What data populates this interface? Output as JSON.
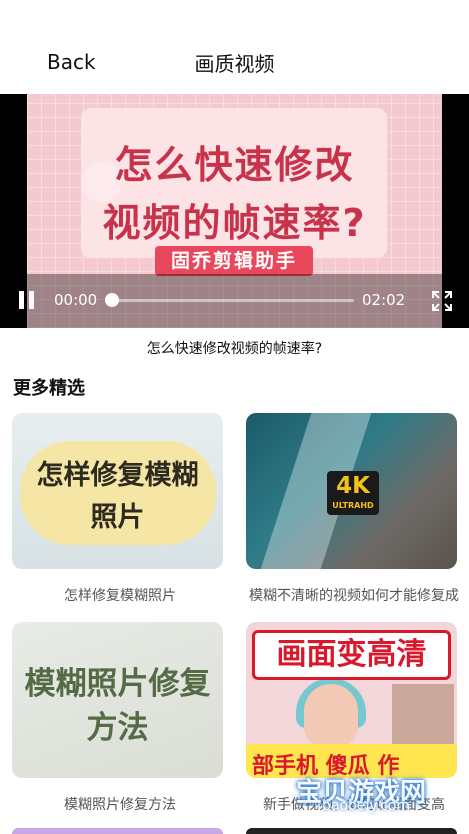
{
  "nav": {
    "back_label": "Back",
    "title": "画质视频"
  },
  "player": {
    "video_title_line1": "怎么快速修改",
    "video_title_line2": "视频的帧速率?",
    "video_brand": "固乔剪辑助手",
    "current_time": "00:00",
    "duration": "02:02",
    "progress_fraction": 0.0,
    "caption": "怎么快速修改视频的帧速率?"
  },
  "section_title": "更多精选",
  "items": [
    {
      "label": "怎样修复模糊照片",
      "thumb_text_1": "怎样修复模糊",
      "thumb_text_2": "照片"
    },
    {
      "label": "模糊不清晰的视频如何才能修复成",
      "badge": "4K",
      "badge_sub": "ULTRAHD"
    },
    {
      "label": "模糊照片修复方法",
      "thumb_text_1": "模糊照片修复",
      "thumb_text_2": "方法"
    },
    {
      "label": "新手做视频，如何让画面变高",
      "thumb_text_1": "画面变高清",
      "thumb_text_2": "部手机 傻瓜 作"
    }
  ],
  "watermark": {
    "text": "宝贝游戏网",
    "sub": "baobeiy.com"
  },
  "colors": {
    "accent_red": "#d9182b",
    "video_pink": "#f4c9cf"
  }
}
